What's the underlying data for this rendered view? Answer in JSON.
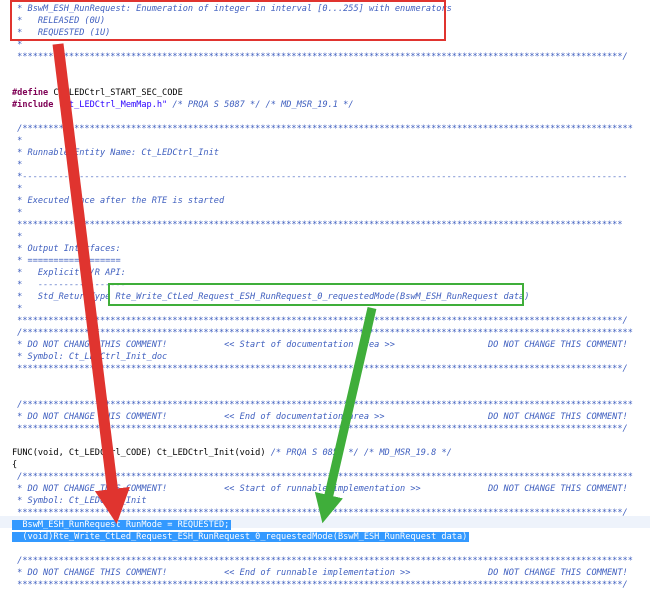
{
  "editor": {
    "lines": [
      {
        "text": " * BswM_ESH_RunRequest: Enumeration of integer in interval [0...255] with enumerators"
      },
      {
        "text": " *   RELEASED (0U)"
      },
      {
        "text": " *   REQUESTED (1U)"
      },
      {
        "text": " *"
      },
      {
        "text": " *********************************************************************************************************************/"
      },
      {
        "text": ""
      },
      {
        "text": ""
      },
      {
        "pp": "#define",
        "plain": " Ct_LEDCtrl_START_SEC_CODE"
      },
      {
        "pp": "#include",
        "str": " \"Ct_LEDCtrl_MemMap.h\"",
        "cmt": " /* PRQA S 5087 */ /* MD_MSR_19.1 */"
      },
      {
        "text": ""
      },
      {
        "text": " /**********************************************************************************************************************"
      },
      {
        "text": " *"
      },
      {
        "text": " * Runnable Entity Name: Ct_LEDCtrl_Init"
      },
      {
        "text": " *"
      },
      {
        "text": " *---------------------------------------------------------------------------------------------------------------------"
      },
      {
        "text": " *"
      },
      {
        "text": " * Executed once after the RTE is started"
      },
      {
        "text": " *"
      },
      {
        "text": " *********************************************************************************************************************"
      },
      {
        "text": " *"
      },
      {
        "text": " * Output Interfaces:"
      },
      {
        "text": " * =================="
      },
      {
        "text": " *   Explicit S/R API:"
      },
      {
        "text": " *   -----------------"
      },
      {
        "text": " *   Std_ReturnType Rte_Write_CtLed_Request_ESH_RunRequest_0_requestedMode(BswM_ESH_RunRequest data)"
      },
      {
        "text": " *"
      },
      {
        "text": " *********************************************************************************************************************/"
      },
      {
        "text": " /**********************************************************************************************************************"
      },
      {
        "text": " * DO NOT CHANGE THIS COMMENT!           << Start of documentation area >>                  DO NOT CHANGE THIS COMMENT!"
      },
      {
        "text": " * Symbol: Ct_LEDCtrl_Init_doc"
      },
      {
        "text": " *********************************************************************************************************************/"
      },
      {
        "text": ""
      },
      {
        "text": ""
      },
      {
        "text": " /**********************************************************************************************************************"
      },
      {
        "text": " * DO NOT CHANGE THIS COMMENT!           << End of documentation area >>                    DO NOT CHANGE THIS COMMENT!"
      },
      {
        "text": " *********************************************************************************************************************/"
      },
      {
        "text": ""
      },
      {
        "plain": "FUNC(void, Ct_LEDCtrl_CODE) Ct_LEDCtrl_Init(void)",
        "cmt": " /* PRQA S 0850 */ /* MD_MSR_19.8 */"
      },
      {
        "plain": "{"
      },
      {
        "text": " /**********************************************************************************************************************"
      },
      {
        "text": " * DO NOT CHANGE THIS COMMENT!           << Start of runnable implementation >>             DO NOT CHANGE THIS COMMENT!"
      },
      {
        "text": " * Symbol: Ct_LEDCtrl_Init"
      },
      {
        "text": " *********************************************************************************************************************/"
      },
      {
        "selected": "  BswM_ESH_RunRequest RunMode = REQUESTED;"
      },
      {
        "selected": "  (void)Rte_Write_CtLed_Request_ESH_RunRequest_0_requestedMode(BswM_ESH_RunRequest data)"
      },
      {
        "text": ""
      },
      {
        "text": " /**********************************************************************************************************************"
      },
      {
        "text": " * DO NOT CHANGE THIS COMMENT!           << End of runnable implementation >>               DO NOT CHANGE THIS COMMENT!"
      },
      {
        "text": " *********************************************************************************************************************/"
      }
    ]
  },
  "annotations": {
    "box_color_red": "#e0342f",
    "box_color_green": "#3fae3a",
    "arrow_color_red": "#e0342f",
    "arrow_color_green": "#3fae3a"
  }
}
